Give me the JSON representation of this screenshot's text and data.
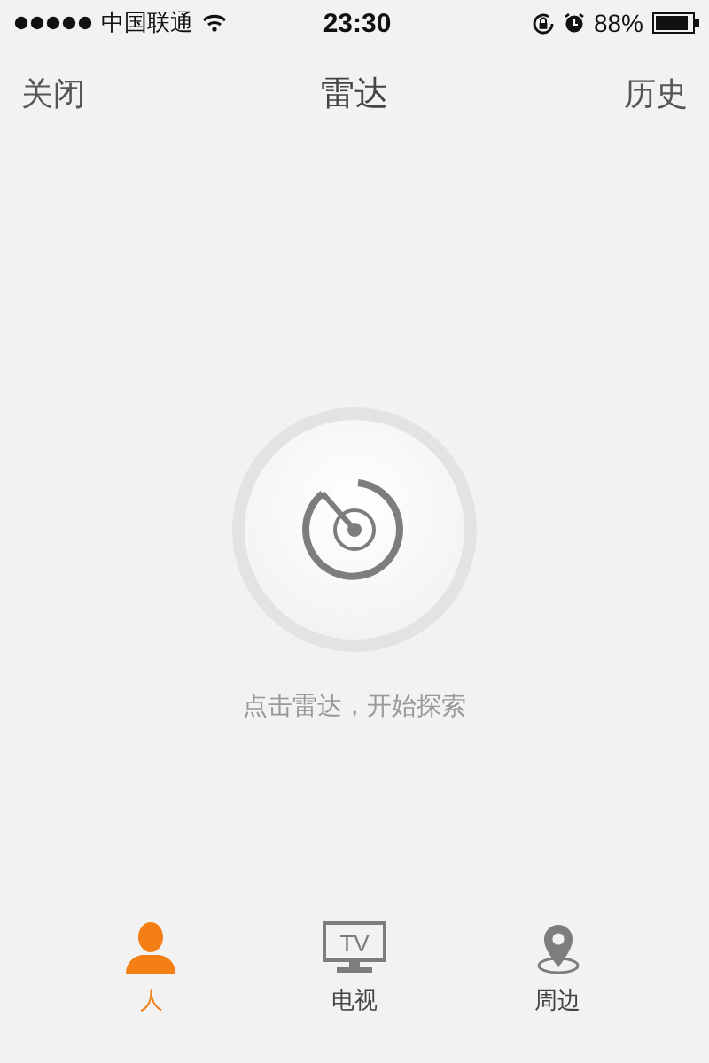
{
  "status_bar": {
    "carrier": "中国联通",
    "time": "23:30",
    "battery": "88%"
  },
  "nav": {
    "left": "关闭",
    "title": "雷达",
    "right": "历史"
  },
  "radar": {
    "hint": "点击雷达，开始探索"
  },
  "tabs": [
    {
      "kind": "person",
      "label": "人",
      "selected": true
    },
    {
      "kind": "tv",
      "icon_text": "TV",
      "label": "电视",
      "selected": false
    },
    {
      "kind": "pin",
      "label": "周边",
      "selected": false
    }
  ]
}
